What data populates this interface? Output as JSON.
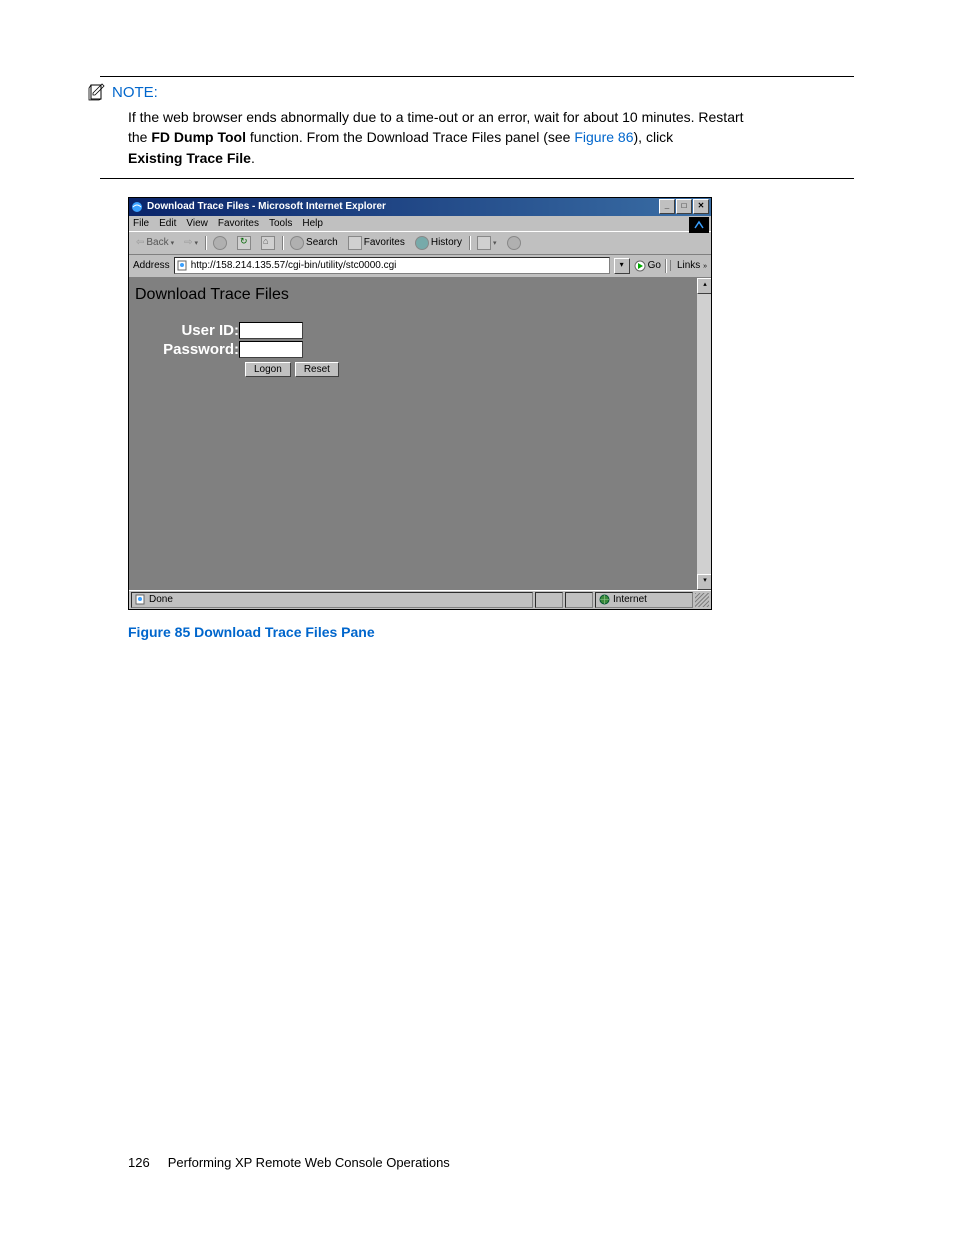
{
  "note": {
    "heading": "NOTE:",
    "line1_a": "If the web browser ends abnormally due to a time-out or an error, wait for about 10 minutes. Restart",
    "line2_a": "the ",
    "bold1": "FD Dump Tool",
    "line2_b": " function. From the Download Trace Files panel (see ",
    "link": "Figure 86",
    "line2_c": "), click",
    "line3_bold": "Existing Trace File",
    "line3_end": "."
  },
  "browser": {
    "title": "Download Trace Files  - Microsoft Internet Explorer",
    "menus": [
      "File",
      "Edit",
      "View",
      "Favorites",
      "Tools",
      "Help"
    ],
    "toolbar": {
      "back": "Back",
      "search": "Search",
      "favorites": "Favorites",
      "history": "History"
    },
    "addressbar": {
      "label": "Address",
      "url": "http://158.214.135.57/cgi-bin/utility/stc0000.cgi",
      "go": "Go",
      "links": "Links"
    },
    "content": {
      "page_title": "Download Trace Files",
      "user_id_label": "User ID:",
      "password_label": "Password:",
      "logon": "Logon",
      "reset": "Reset"
    },
    "statusbar": {
      "done": "Done",
      "zone": "Internet"
    }
  },
  "figure_caption": "Figure 85 Download Trace Files Pane",
  "footer": {
    "page_num": "126",
    "chapter": "Performing XP Remote Web Console Operations"
  }
}
